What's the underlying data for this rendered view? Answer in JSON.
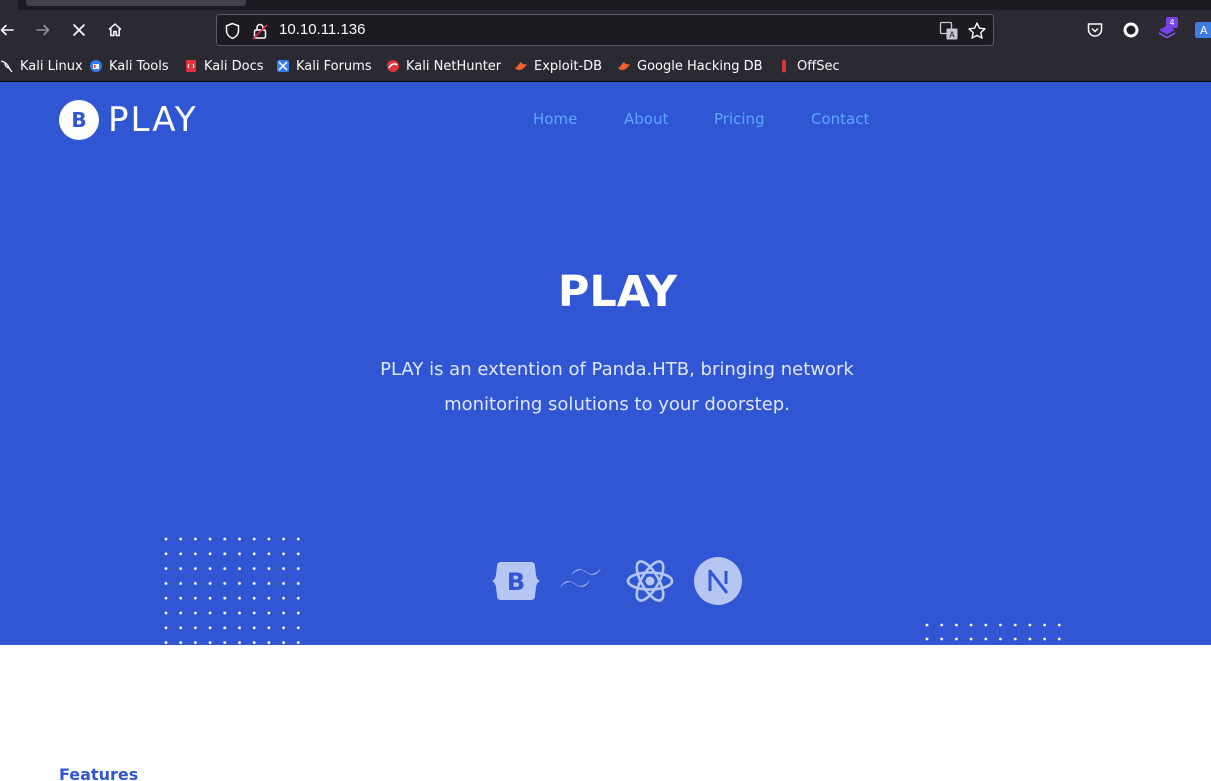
{
  "browser": {
    "url": "10.10.11.136",
    "extension_badge": "4",
    "bookmarks": [
      {
        "label": "Kali Linux",
        "icon": "kali-dragon-icon"
      },
      {
        "label": "Kali Tools",
        "icon": "kali-tools-icon"
      },
      {
        "label": "Kali Docs",
        "icon": "kali-docs-icon"
      },
      {
        "label": "Kali Forums",
        "icon": "kali-forums-icon"
      },
      {
        "label": "Kali NetHunter",
        "icon": "nethunter-icon"
      },
      {
        "label": "Exploit-DB",
        "icon": "exploit-db-icon"
      },
      {
        "label": "Google Hacking DB",
        "icon": "ghdb-icon"
      },
      {
        "label": "OffSec",
        "icon": "offsec-icon"
      }
    ]
  },
  "site": {
    "brand_name": "PLAY",
    "brand_logo_letter": "B",
    "nav": [
      "Home",
      "About",
      "Pricing",
      "Contact"
    ],
    "hero": {
      "title": "PLAY",
      "description": "PLAY is an extention of Panda.HTB, bringing network monitoring solutions to your doorstep."
    },
    "tech_icons": [
      "bootstrap-icon",
      "tailwind-icon",
      "react-icon",
      "nextjs-icon"
    ],
    "features_label": "Features"
  },
  "colors": {
    "hero_bg": "#3056d3",
    "nav_link": "#5aa6ff",
    "browser_chrome": "#2b2a33",
    "url_field": "#1c1b22"
  }
}
